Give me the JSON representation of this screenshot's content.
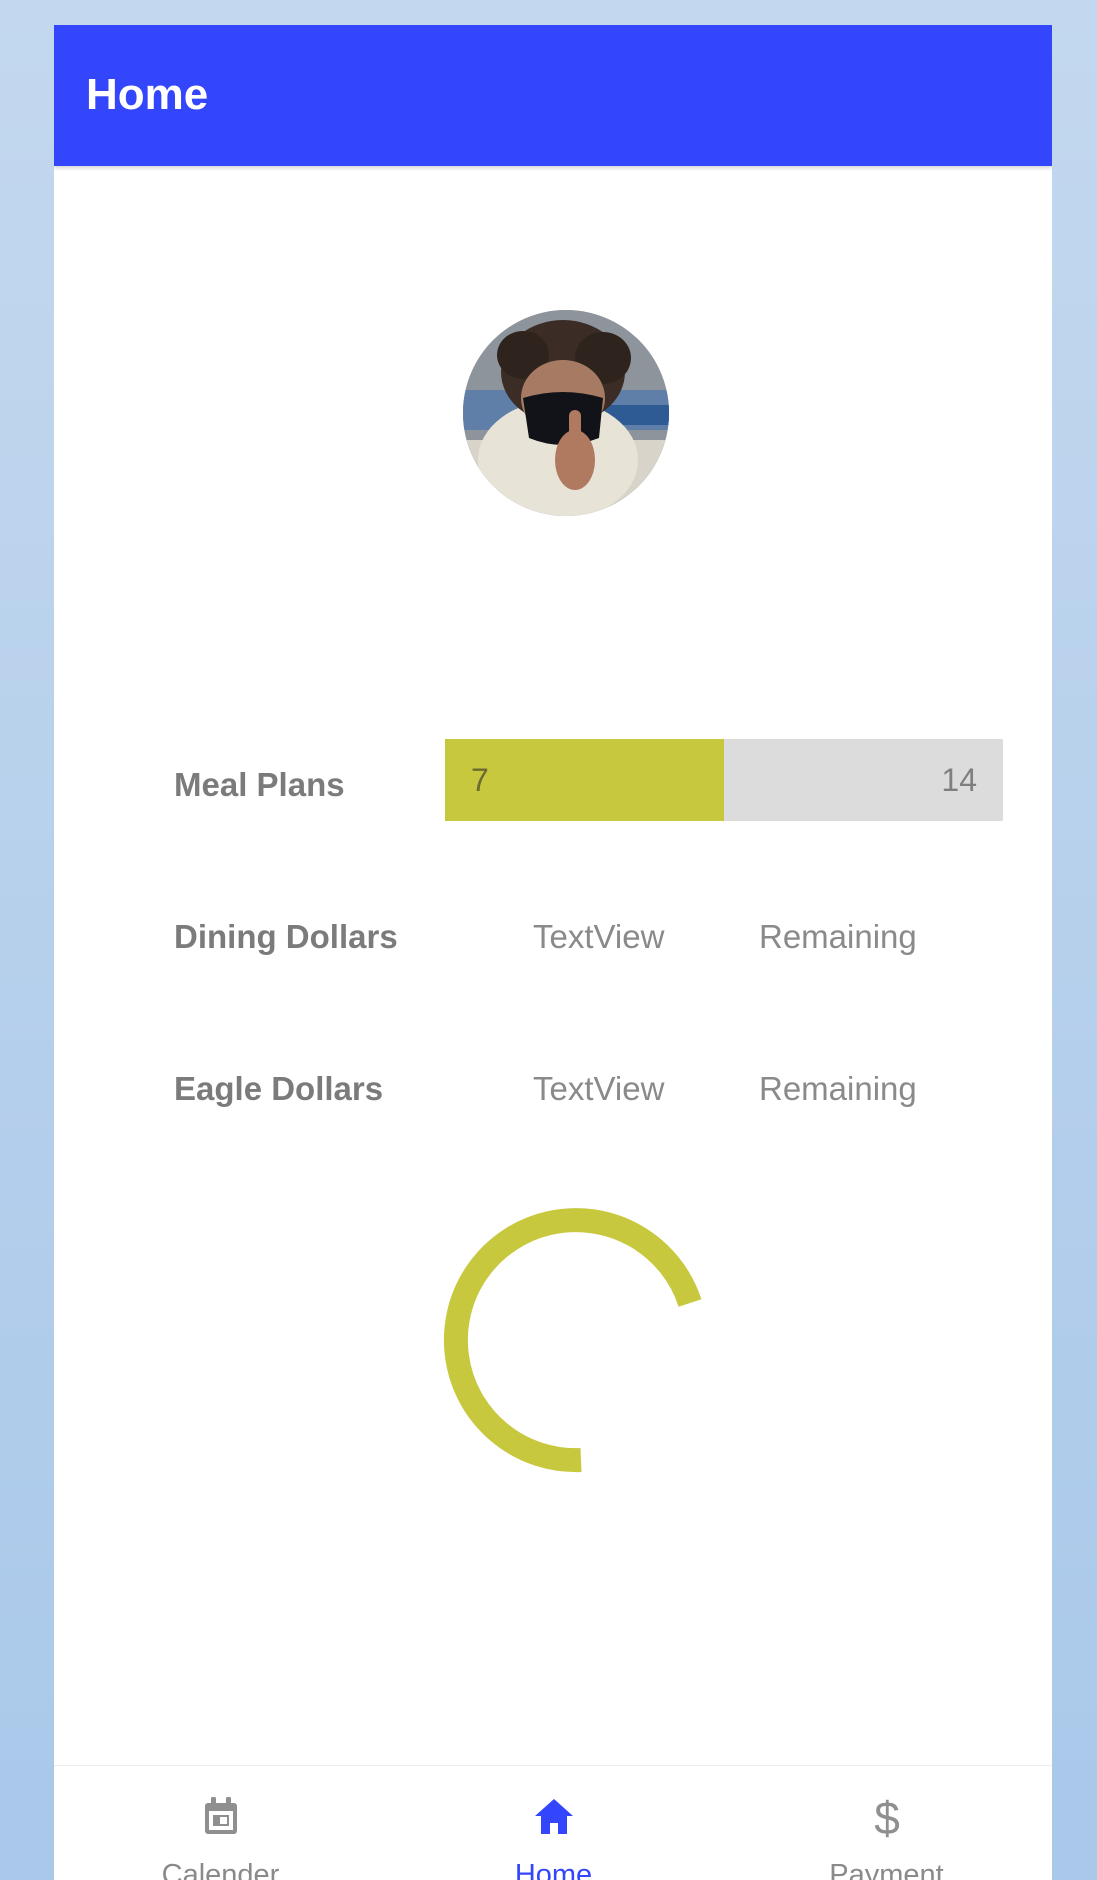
{
  "app_bar": {
    "title": "Home"
  },
  "colors": {
    "primary": "#3346fb",
    "accent": "#c8c83f",
    "track": "#dcdcdc"
  },
  "meal_plans": {
    "label": "Meal Plans",
    "current": "7",
    "max": "14",
    "fill_fraction": 0.5
  },
  "dining_dollars": {
    "label": "Dining Dollars",
    "value": "TextView",
    "suffix": "Remaining"
  },
  "eagle_dollars": {
    "label": "Eagle Dollars",
    "value": "TextView",
    "suffix": "Remaining"
  },
  "spinner": {
    "icon": "loading-spinner-icon"
  },
  "bottom_nav": {
    "items": [
      {
        "label": "Calender",
        "icon": "calendar-icon",
        "active": false
      },
      {
        "label": "Home",
        "icon": "home-icon",
        "active": true
      },
      {
        "label": "Payment",
        "icon": "dollar-icon",
        "active": false
      }
    ]
  }
}
